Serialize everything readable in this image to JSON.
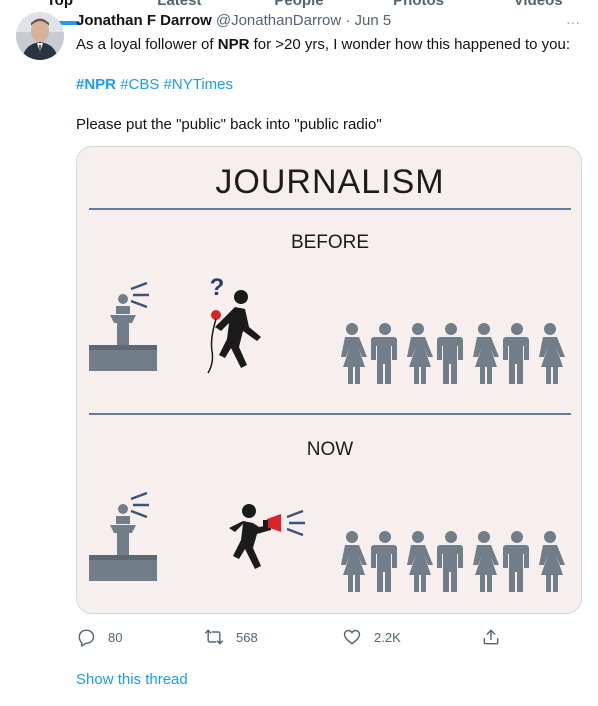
{
  "tabs": [
    {
      "label": "Top"
    },
    {
      "label": "Latest"
    },
    {
      "label": "People"
    },
    {
      "label": "Photos"
    },
    {
      "label": "Videos"
    }
  ],
  "tweet": {
    "author_name": "Jonathan F Darrow",
    "author_handle": "@JonathanDarrow",
    "date": "· Jun 5",
    "text_prefix": "As a loyal follower of ",
    "text_bold": "NPR",
    "text_suffix": " for >20 yrs, I wonder how this happened to you:",
    "hashtags": [
      "#NPR",
      "#CBS",
      "#NYTimes"
    ],
    "second_line": "Please put the \"public\" back into \"public radio\"",
    "image": {
      "title": "JOURNALISM",
      "section_before": "BEFORE",
      "section_now": "NOW",
      "question_mark": "?"
    },
    "actions": {
      "reply_count": "80",
      "retweet_count": "568",
      "like_count": "2.2K"
    },
    "show_thread": "Show this thread"
  },
  "colors": {
    "accent": "#1d9bf0",
    "muted": "#536471",
    "card_bg": "#f6efed",
    "figure_gray": "#717d89",
    "divider_blue": "#3a5577",
    "mic_red": "#d9242a"
  }
}
